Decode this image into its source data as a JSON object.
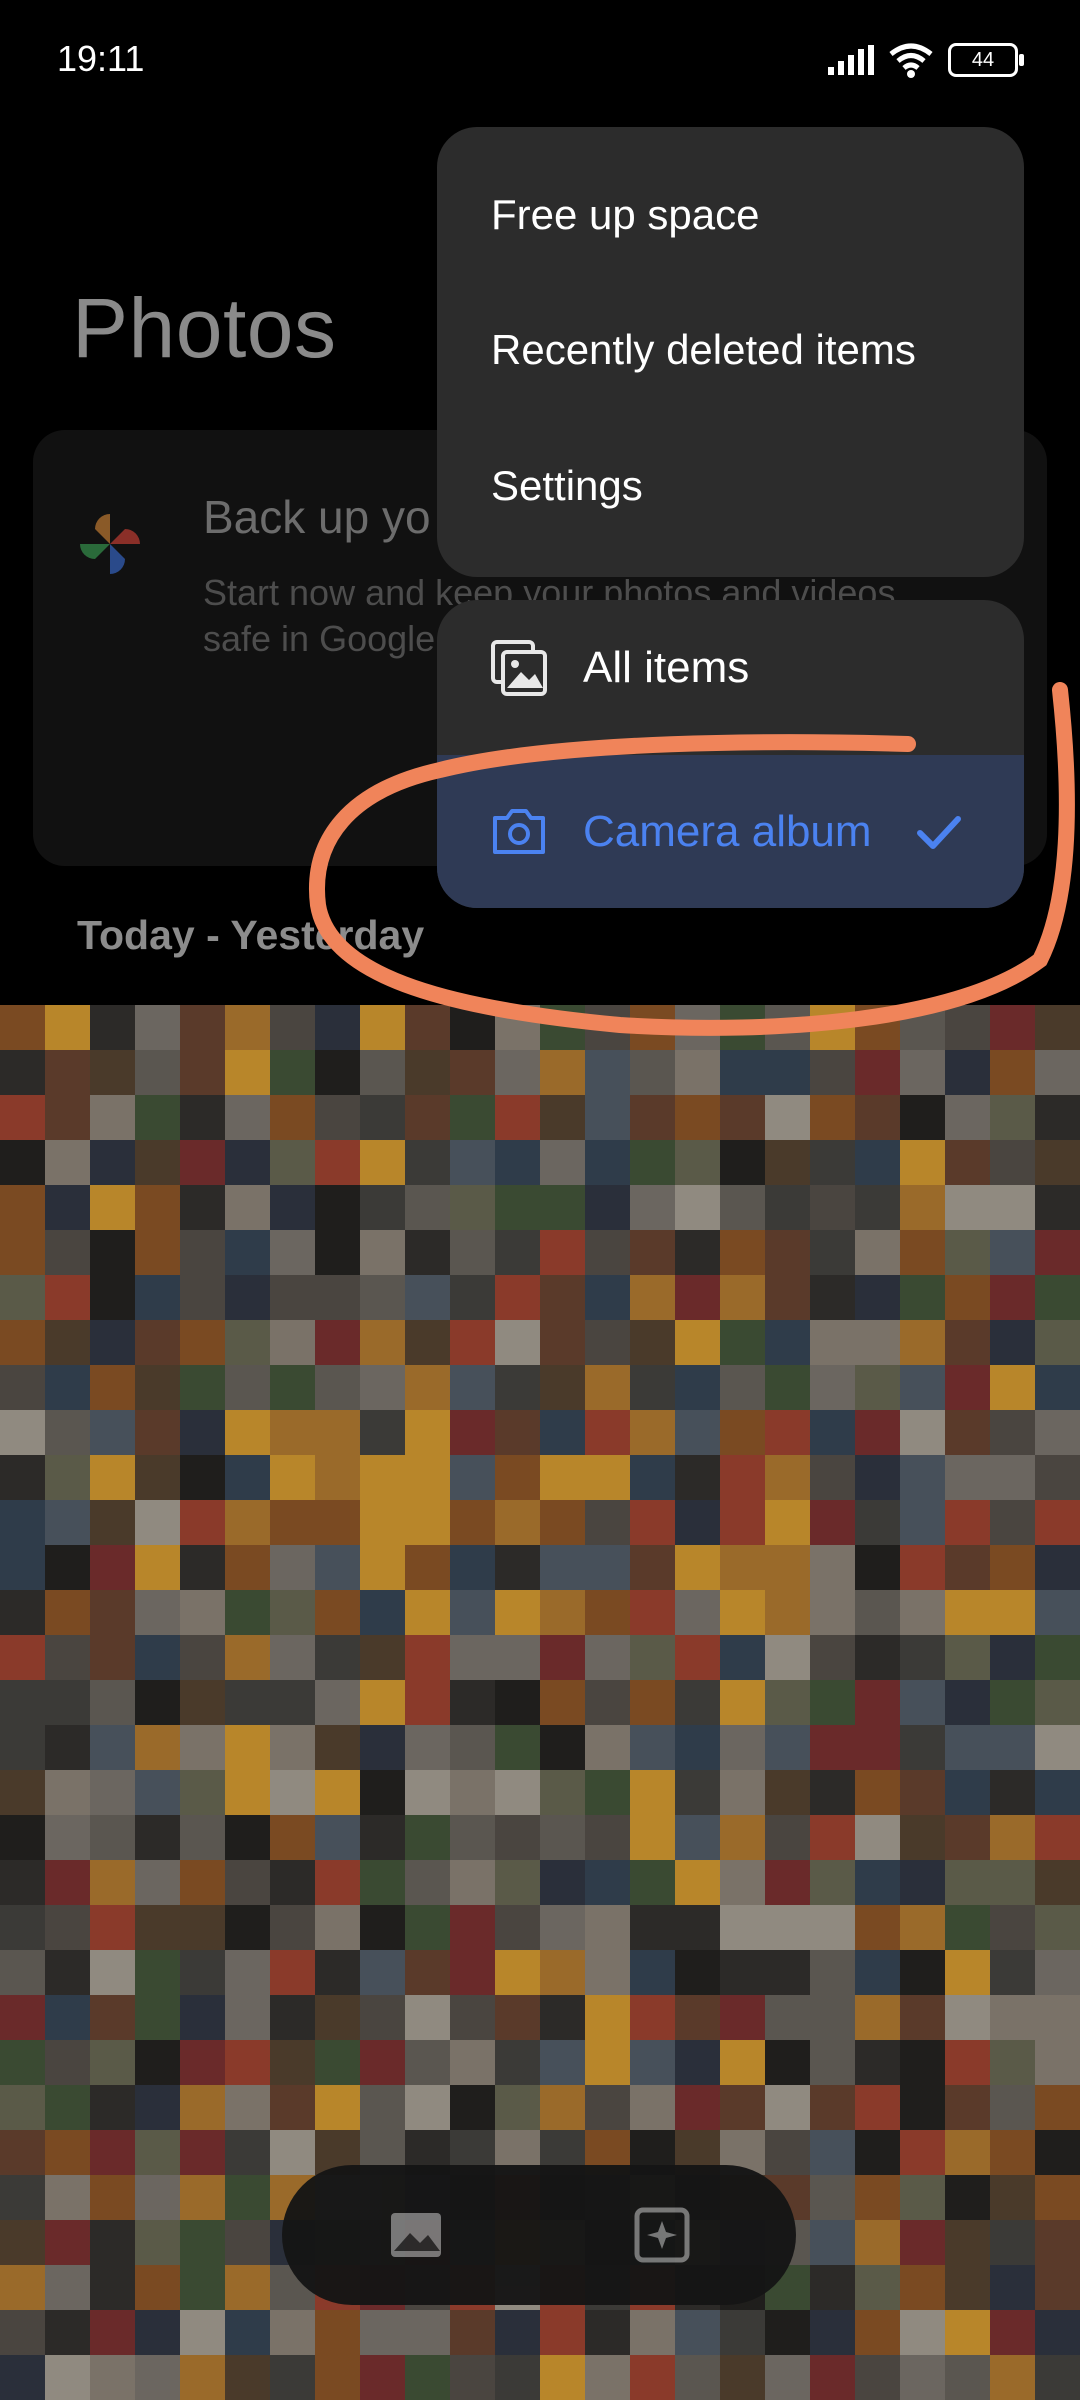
{
  "status_bar": {
    "time": "19:11",
    "battery": "44"
  },
  "page": {
    "title": "Photos",
    "date_header": "Today - Yesterday"
  },
  "backup_card": {
    "title": "Back up yo",
    "subtitle": "Start now and keep your photos and videos safe in Google"
  },
  "menu": {
    "items": [
      "Free up space",
      "Recently deleted items",
      "Settings"
    ]
  },
  "albums": {
    "items": [
      {
        "label": "All items",
        "icon": "gallery-stack-icon",
        "selected": false
      },
      {
        "label": "Camera album",
        "icon": "camera-icon",
        "selected": true
      }
    ]
  },
  "bottom_nav": {
    "icons": [
      "photo-icon",
      "sparkle-icon"
    ]
  },
  "colors": {
    "accent": "#4b82f0",
    "selected_bg": "#2f3a55",
    "menu_bg": "#2c2c2c",
    "annotation": "#f0845a"
  }
}
